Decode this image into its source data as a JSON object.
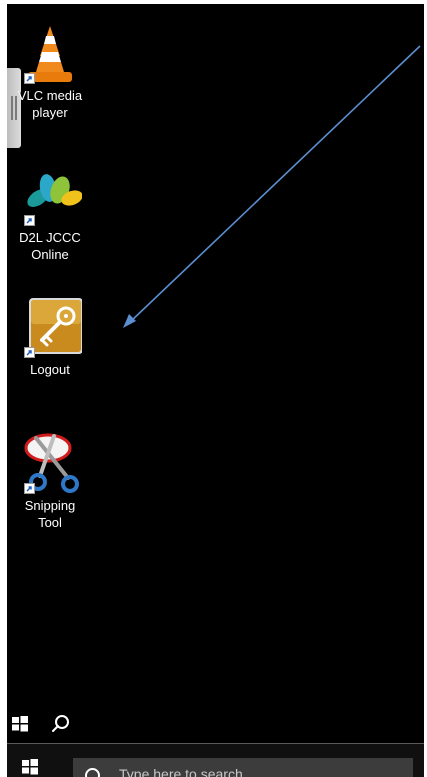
{
  "desktop": {
    "icons": [
      {
        "name": "vlc",
        "label": "VLC media player",
        "icon": "vlc-cone-icon"
      },
      {
        "name": "d2l",
        "label": "D2L JCCC Online",
        "icon": "d2l-leaf-icon"
      },
      {
        "name": "logout",
        "label": "Logout",
        "icon": "key-icon"
      },
      {
        "name": "snipping",
        "label": "Snipping\nTool",
        "icon": "scissors-icon"
      }
    ],
    "annotation": "arrow-pointer",
    "arrow_color": "#5b8fd0"
  },
  "taskbar": {
    "search_placeholder": "Type here to search",
    "start_icon": "windows-start-icon",
    "search_icon": "search-icon"
  },
  "colors": {
    "desktop_bg": "#000000",
    "taskbar_bg": "#101010",
    "logout_tile": "#c98a1e"
  }
}
